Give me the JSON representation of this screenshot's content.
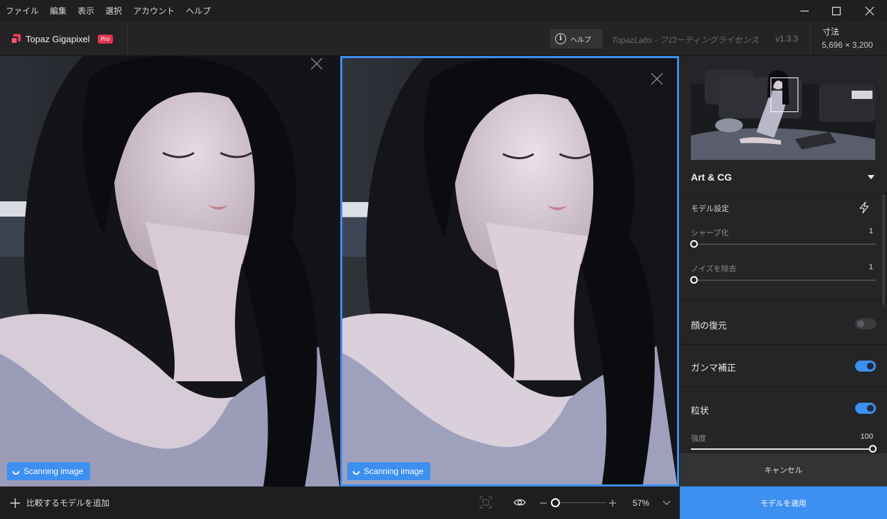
{
  "menubar": {
    "items": [
      "ファイル",
      "編集",
      "表示",
      "選択",
      "アカウント",
      "ヘルプ"
    ]
  },
  "header": {
    "brand": "Topaz Gigapixel",
    "badge": "Pro",
    "help_label": "ヘルプ",
    "license": "TopazLabs - フローティングライセンス",
    "version": "v1.3.3",
    "dimensions_label": "寸法",
    "dimensions_value": "5,696 × 3,200"
  },
  "preview": {
    "scan_label": "Scanning image"
  },
  "sidebar": {
    "model_name": "Art & CG",
    "settings_title": "モデル設定",
    "sharpen": {
      "label": "シャープ化",
      "value": "1",
      "level": 0
    },
    "denoise": {
      "label": "ノイズを除去",
      "value": "1",
      "level": 0
    },
    "face_recovery": {
      "label": "顔の復元",
      "on": false
    },
    "gamma": {
      "label": "ガンマ補正",
      "on": true
    },
    "grain": {
      "label": "粒状",
      "on": true
    },
    "strength": {
      "label": "強度",
      "value": "100",
      "level": 1.0
    },
    "cancel_label": "キャンセル",
    "apply_label": "モデルを適用"
  },
  "bottombar": {
    "add_compare_label": "比較するモデルを追加",
    "zoom": "57%"
  },
  "colors": {
    "accent": "#3d8ff0",
    "brand": "#e23b52",
    "panel": "#252527"
  }
}
